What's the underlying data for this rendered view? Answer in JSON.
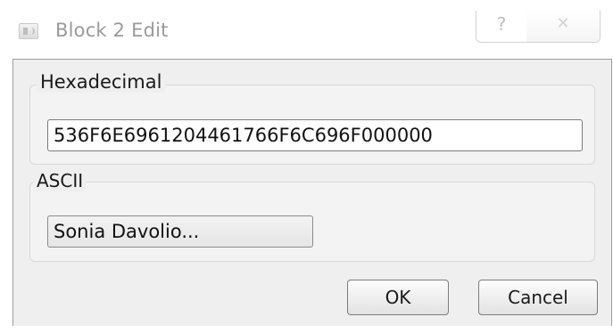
{
  "window": {
    "title": "Block 2 Edit",
    "help_glyph": "?",
    "close_glyph": "✕"
  },
  "hex_group": {
    "label": "Hexadecimal",
    "value": "536F6E6961204461766F6C696F000000"
  },
  "ascii_group": {
    "label": "ASCII",
    "value": "Sonia Davolio..."
  },
  "buttons": {
    "ok_label": "OK",
    "cancel_label": "Cancel"
  },
  "icons": {
    "app_icon": "app-icon",
    "help_icon": "help-icon",
    "close_icon": "close-icon"
  }
}
